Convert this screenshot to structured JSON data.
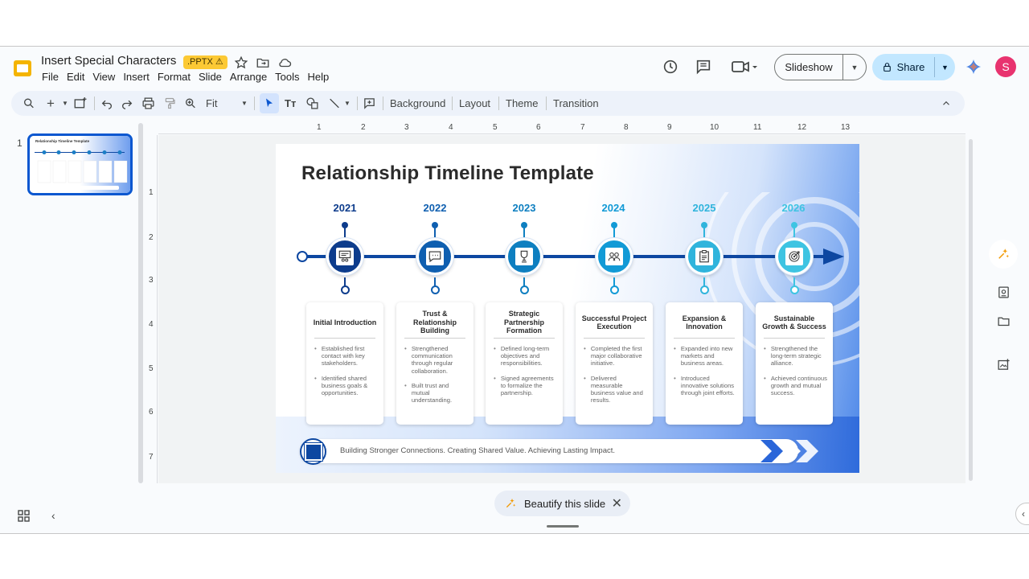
{
  "app": {
    "title": "Insert Special Characters",
    "badge": ".PPTX ⚠",
    "menu": [
      "File",
      "Edit",
      "View",
      "Insert",
      "Format",
      "Slide",
      "Arrange",
      "Tools",
      "Help"
    ],
    "slideshow_label": "Slideshow",
    "share_label": "Share",
    "avatar_initial": "S"
  },
  "toolbar": {
    "zoom_label": "Fit",
    "background_label": "Background",
    "layout_label": "Layout",
    "theme_label": "Theme",
    "transition_label": "Transition"
  },
  "filmstrip": {
    "slide_number": "1"
  },
  "ruler": {
    "h_ticks": [
      "1",
      "2",
      "3",
      "4",
      "5",
      "6",
      "7",
      "8",
      "9",
      "10",
      "11",
      "12",
      "13"
    ],
    "v_ticks": [
      "1",
      "2",
      "3",
      "4",
      "5",
      "6",
      "7"
    ]
  },
  "slide": {
    "title": "Relationship Timeline Template",
    "milestones": [
      {
        "year": "2021",
        "color": "#0d3c8c",
        "title": "Initial Introduction",
        "bullets": [
          "Established first contact with key stakeholders.",
          "Identified shared business goals & opportunities."
        ]
      },
      {
        "year": "2022",
        "color": "#0f5fb0",
        "title": "Trust & Relationship Building",
        "bullets": [
          "Strengthened communication through regular collaboration.",
          "Built trust and mutual understanding."
        ]
      },
      {
        "year": "2023",
        "color": "#0e7fc0",
        "title": "Strategic Partnership Formation",
        "bullets": [
          "Defined long-term objectives and responsibilities.",
          "Signed agreements to formalize the partnership."
        ]
      },
      {
        "year": "2024",
        "color": "#129ad6",
        "title": "Successful Project Execution",
        "bullets": [
          "Completed the first major collaborative initiative.",
          "Delivered measurable business value and results."
        ]
      },
      {
        "year": "2025",
        "color": "#30b4dc",
        "title": "Expansion & Innovation",
        "bullets": [
          "Expanded into new markets and business areas.",
          "Introduced innovative solutions through joint efforts."
        ]
      },
      {
        "year": "2026",
        "color": "#3ec4e2",
        "title": "Sustainable Growth & Success",
        "bullets": [
          "Strengthened the long-term strategic alliance.",
          "Achieved continuous growth and mutual success."
        ]
      }
    ],
    "footer": "Building Stronger Connections. Creating Shared Value. Achieving Lasting Impact."
  },
  "thumb": {
    "title": "Relationship Timeline Template"
  },
  "bottom": {
    "beautify_label": "Beautify this slide"
  }
}
